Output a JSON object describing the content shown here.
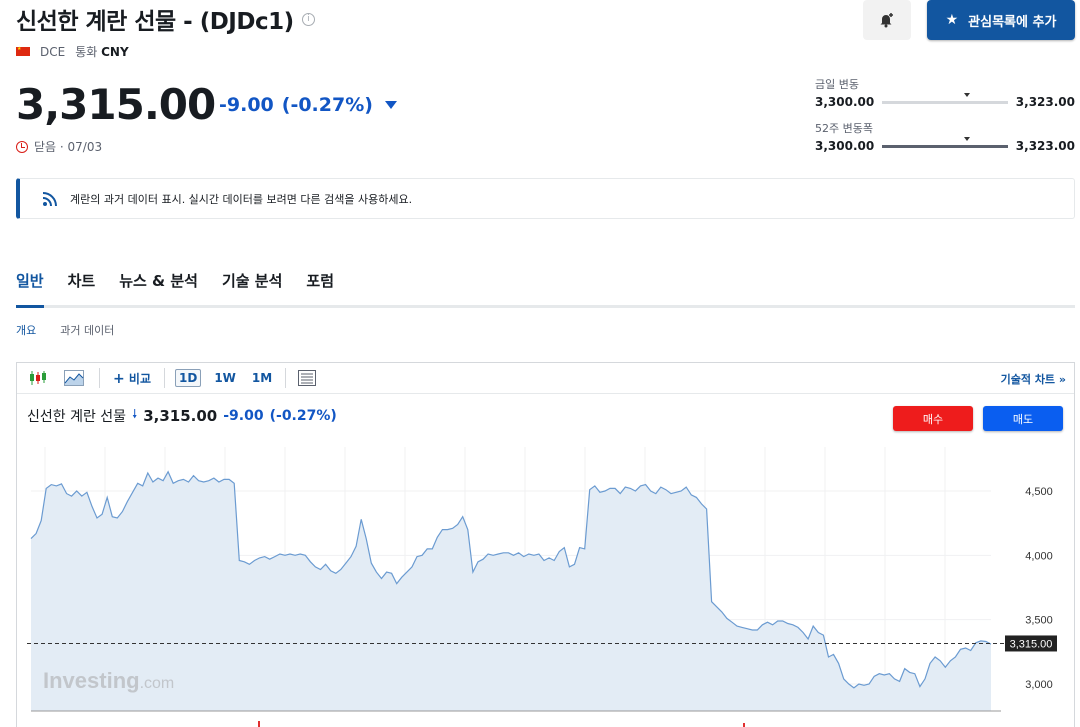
{
  "header": {
    "title": "신선한 계란 선물 - (DJDc1)",
    "info_icon": "info-circle-icon",
    "exchange": "DCE",
    "currency_label": "통화",
    "currency": "CNY",
    "bell_icon": "bell-plus-icon",
    "watchlist_label": "관심목록에 추가"
  },
  "quote": {
    "price": "3,315.00",
    "change": "-9.00",
    "change_pct": "(-0.27%)",
    "status": "닫음 · 07/03"
  },
  "ranges": {
    "day_label": "금일 변동",
    "day_low": "3,300.00",
    "day_high": "3,323.00",
    "day_position": 0.65,
    "week52_label": "52주 변동폭",
    "week52_low": "3,300.00",
    "week52_high": "3,323.00",
    "week52_position": 0.65
  },
  "notice": {
    "text": "계란의 과거 데이터 표시. 실시간 데이터를 보려면 다른 검색을 사용하세요."
  },
  "tabs": [
    "일반",
    "차트",
    "뉴스 & 분석",
    "기술 분석",
    "포럼"
  ],
  "subtabs": [
    "개요",
    "과거 데이터"
  ],
  "toolbar": {
    "compare": "비교",
    "periods": [
      "1D",
      "1W",
      "1M"
    ],
    "tech_chart": "기술적 차트 »"
  },
  "chart_header": {
    "name": "신선한 계란 선물",
    "price": "3,315.00",
    "change": "-9.00",
    "change_pct": "(-0.27%)",
    "buy": "매수",
    "sell": "매도"
  },
  "watermark": "Investing",
  "watermark_suffix": ".com",
  "chart_data": {
    "type": "area",
    "yticks": [
      3000,
      3500,
      4000,
      4500
    ],
    "ytick_labels": [
      "3,000",
      "3,500",
      "4,000",
      "4,500"
    ],
    "ylim": [
      2850,
      4800
    ],
    "last_value": 3315,
    "last_label": "3,315.00",
    "values": [
      4130,
      4170,
      4270,
      4520,
      4550,
      4540,
      4555,
      4480,
      4460,
      4500,
      4460,
      4490,
      4380,
      4290,
      4320,
      4450,
      4300,
      4290,
      4340,
      4420,
      4490,
      4560,
      4540,
      4640,
      4570,
      4600,
      4580,
      4650,
      4560,
      4580,
      4590,
      4570,
      4620,
      4580,
      4570,
      4580,
      4600,
      4570,
      4590,
      4590,
      4560,
      3960,
      3950,
      3930,
      3960,
      3980,
      3990,
      3970,
      3990,
      4010,
      4000,
      4010,
      4000,
      4010,
      4000,
      3950,
      3910,
      3890,
      3930,
      3880,
      3860,
      3890,
      3940,
      3990,
      4070,
      4280,
      4130,
      3940,
      3870,
      3820,
      3870,
      3860,
      3780,
      3830,
      3870,
      3910,
      3990,
      4000,
      4050,
      4050,
      4140,
      4200,
      4200,
      4210,
      4240,
      4300,
      4200,
      3870,
      3950,
      3970,
      4010,
      4000,
      4010,
      4020,
      4020,
      4000,
      4020,
      3990,
      4010,
      4000,
      4010,
      3960,
      3980,
      3960,
      4030,
      4060,
      3910,
      3930,
      4060,
      4050,
      4510,
      4540,
      4490,
      4500,
      4520,
      4520,
      4480,
      4530,
      4520,
      4500,
      4540,
      4550,
      4500,
      4480,
      4530,
      4510,
      4480,
      4490,
      4500,
      4530,
      4470,
      4450,
      4400,
      4360,
      3640,
      3600,
      3560,
      3510,
      3480,
      3450,
      3440,
      3430,
      3420,
      3420,
      3460,
      3480,
      3460,
      3490,
      3490,
      3470,
      3460,
      3440,
      3400,
      3350,
      3450,
      3400,
      3380,
      3210,
      3230,
      3160,
      3040,
      3000,
      2970,
      3000,
      2990,
      3000,
      3060,
      3080,
      3070,
      3080,
      3040,
      3020,
      3120,
      3090,
      3080,
      2980,
      3040,
      3160,
      3210,
      3180,
      3130,
      3180,
      3210,
      3270,
      3280,
      3260,
      3320,
      3335,
      3330,
      3310
    ]
  }
}
